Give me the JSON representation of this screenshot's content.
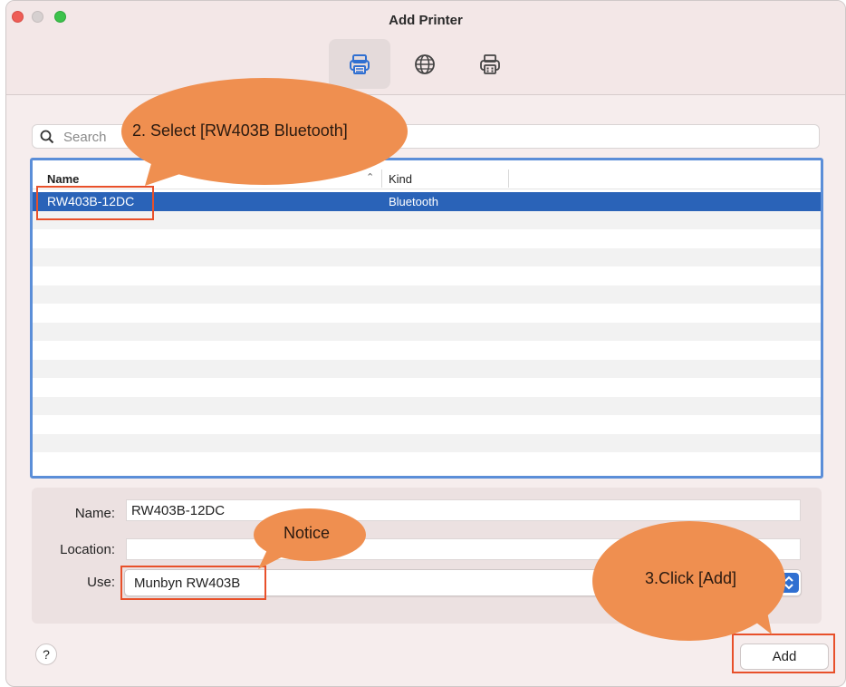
{
  "window": {
    "title": "Add Printer",
    "toolbar": [
      {
        "icon": "printer-icon",
        "active": true
      },
      {
        "icon": "globe-icon",
        "active": false
      },
      {
        "icon": "fax-printer-icon",
        "active": false
      }
    ]
  },
  "search": {
    "placeholder": "Search"
  },
  "list": {
    "columns": {
      "name": "Name",
      "kind": "Kind"
    },
    "rows": [
      {
        "name": "RW403B-12DC",
        "kind": "Bluetooth",
        "selected": true
      }
    ]
  },
  "form": {
    "name_label": "Name:",
    "name_value": "RW403B-12DC",
    "location_label": "Location:",
    "location_value": "",
    "use_label": "Use:",
    "use_value": "Munbyn RW403B"
  },
  "buttons": {
    "help": "?",
    "add": "Add"
  },
  "annotations": {
    "step2": "2. Select [RW403B Bluetooth]",
    "notice": "Notice",
    "step3": "3.Click [Add]",
    "accent_color": "#ef8f50",
    "highlight_color": "#e8502a"
  }
}
